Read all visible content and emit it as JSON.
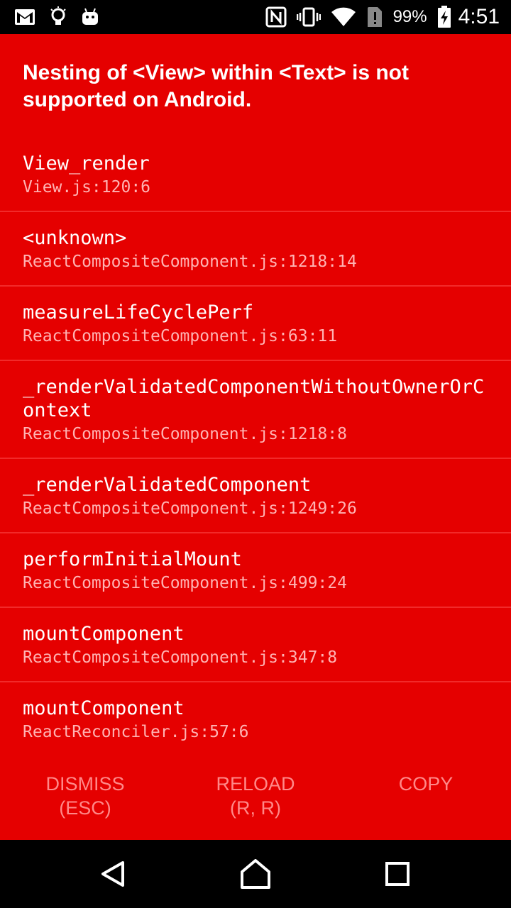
{
  "status_bar": {
    "battery_percent": "99%",
    "time": "4:51",
    "icons": [
      "gmail-icon",
      "lightbulb-icon",
      "android-robot-icon",
      "nfc-icon",
      "vibrate-icon",
      "wifi-icon",
      "sim-alert-icon",
      "battery-charging-icon"
    ]
  },
  "error": {
    "title": "Nesting of <View> within <Text> is not supported on Android."
  },
  "stack": [
    {
      "function": "View_render",
      "location": "View.js:120:6"
    },
    {
      "function": "<unknown>",
      "location": "ReactCompositeComponent.js:1218:14"
    },
    {
      "function": "measureLifeCyclePerf",
      "location": "ReactCompositeComponent.js:63:11"
    },
    {
      "function": "_renderValidatedComponentWithoutOwnerOrContext",
      "location": "ReactCompositeComponent.js:1218:8"
    },
    {
      "function": "_renderValidatedComponent",
      "location": "ReactCompositeComponent.js:1249:26"
    },
    {
      "function": "performInitialMount",
      "location": "ReactCompositeComponent.js:499:24"
    },
    {
      "function": "mountComponent",
      "location": "ReactCompositeComponent.js:347:8"
    },
    {
      "function": "mountComponent",
      "location": "ReactReconciler.js:57:6"
    }
  ],
  "buttons": {
    "dismiss_line1": "DISMISS",
    "dismiss_line2": "(ESC)",
    "reload_line1": "RELOAD",
    "reload_line2": "(R, R)",
    "copy_line1": "COPY"
  },
  "nav": {
    "back": "back-icon",
    "home": "home-icon",
    "recents": "recents-icon"
  },
  "colors": {
    "background": "#e50000",
    "location_text": "#ffb3b3",
    "button_text": "#ff8888"
  }
}
